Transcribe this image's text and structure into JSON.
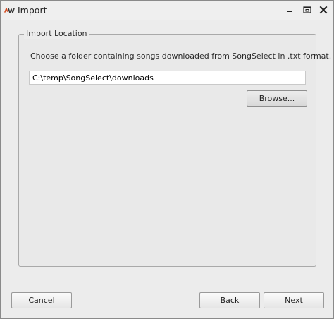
{
  "window": {
    "title": "Import",
    "logo_icon": "worship-app-logo-icon",
    "controls": [
      "minimize-icon",
      "restore-icon",
      "close-icon"
    ]
  },
  "import_location": {
    "legend": "Import Location",
    "instruction": "Choose a folder containing songs downloaded from SongSelect in .txt format.",
    "path_value": "C:\\temp\\SongSelect\\downloads",
    "browse_label": "Browse..."
  },
  "footer": {
    "cancel_label": "Cancel",
    "back_label": "Back",
    "next_label": "Next"
  },
  "colors": {
    "window_bg": "#ececec",
    "group_border": "#a9a9a9",
    "logo_red": "#d44a1e",
    "logo_dark": "#3a3a3a"
  }
}
